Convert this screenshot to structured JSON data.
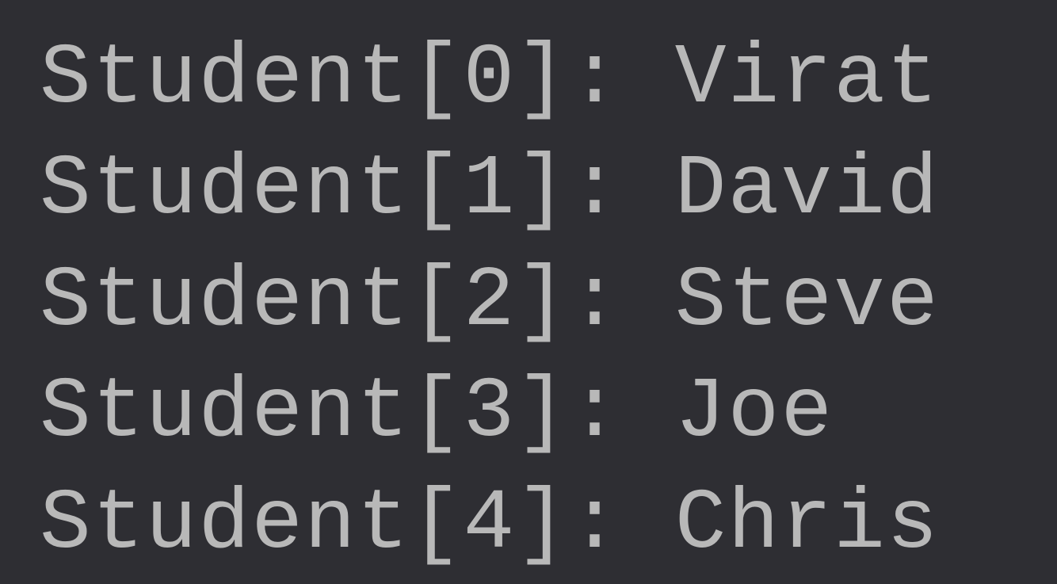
{
  "console": {
    "lines": [
      "Student[0]: Virat",
      "Student[1]: David",
      "Student[2]: Steve",
      "Student[3]: Joe",
      "Student[4]: Chris"
    ]
  }
}
